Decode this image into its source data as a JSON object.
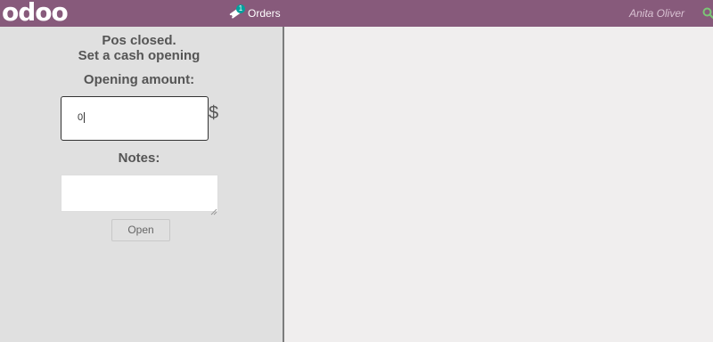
{
  "header": {
    "logo_text": "odoo",
    "orders_label": "Orders",
    "orders_count": "1",
    "user_name": "Anita Oliver",
    "icons": [
      "ticket-icon",
      "search-icon"
    ],
    "colors": {
      "bar": "#875a7b",
      "badge": "#01a09d",
      "search": "#7cc576"
    }
  },
  "cash_open": {
    "status_line1": "Pos closed.",
    "status_line2": "Set a cash opening",
    "opening_label": "Opening amount:",
    "opening_value": "0",
    "currency_symbol": "$",
    "notes_label": "Notes:",
    "notes_value": "",
    "open_button": "Open"
  }
}
